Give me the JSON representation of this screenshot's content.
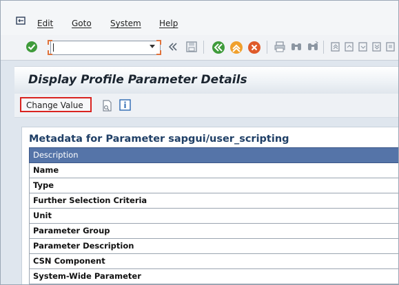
{
  "menubar": {
    "items": [
      "Edit",
      "Goto",
      "System",
      "Help"
    ]
  },
  "toolbar": {
    "command_value": ""
  },
  "page_title": "Display Profile Parameter Details",
  "app_toolbar": {
    "change_value_label": "Change Value"
  },
  "metadata": {
    "title": "Metadata for Parameter sapgui/user_scripting",
    "header": "Description",
    "rows": [
      "Name",
      "Type",
      "Further Selection Criteria",
      "Unit",
      "Parameter Group",
      "Parameter Description",
      "CSN Component",
      "System-Wide Parameter"
    ]
  },
  "colors": {
    "header_blue": "#5574a8",
    "highlight_red": "#d9231f",
    "title_blue": "#1f3f66"
  }
}
